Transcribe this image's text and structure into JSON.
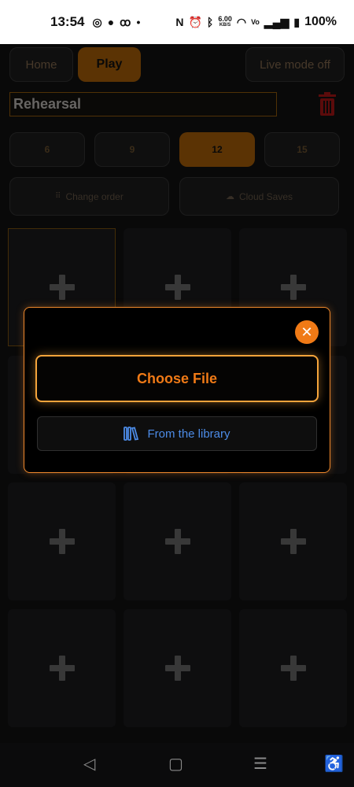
{
  "status_bar": {
    "time": "13:54",
    "net_speed": "6.00",
    "net_unit": "KB/S",
    "battery": "100%",
    "icons": [
      "whatsapp-icon",
      "chat-icon",
      "voicemail-icon",
      "dot-icon",
      "nfc-icon",
      "alarm-icon",
      "bluetooth-icon",
      "wifi-icon",
      "volte-icon",
      "signal-icon",
      "battery-icon"
    ]
  },
  "header": {
    "home_label": "Home",
    "play_label": "Play",
    "live_mode_label": "Live mode off"
  },
  "set_name": "Rehearsal",
  "grid_sizes": [
    "6",
    "9",
    "12",
    "15"
  ],
  "actions": {
    "change_order": "Change order",
    "cloud_saves": "Cloud Saves"
  },
  "dialog": {
    "choose_file": "Choose File",
    "from_library": "From the library",
    "close_symbol": "✕"
  },
  "colors": {
    "accent": "#f07a16",
    "accent_dim": "#7a4506",
    "library_blue": "#4c8be6",
    "trash_red": "#7a0f0f"
  }
}
